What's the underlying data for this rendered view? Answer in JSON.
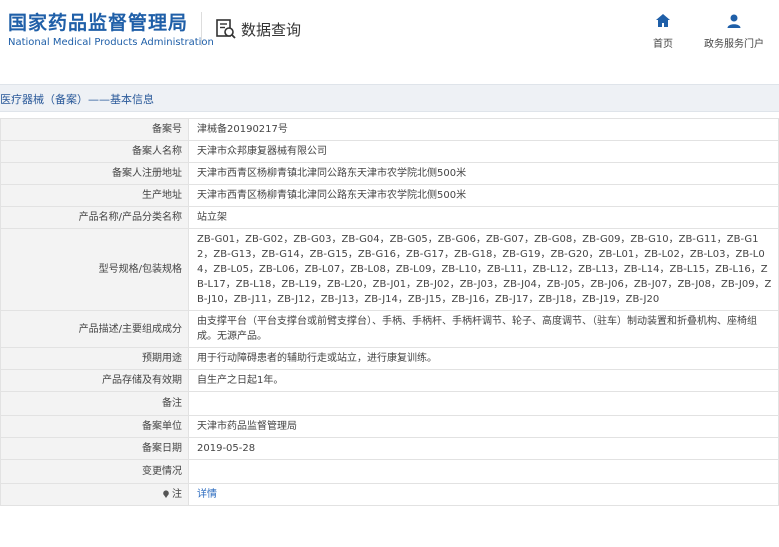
{
  "header": {
    "logo_cn": "国家药品监督管理局",
    "logo_en": "National Medical Products Administration",
    "query_label": "数据查询",
    "nav_home": "首页",
    "nav_gov": "政务服务门户"
  },
  "breadcrumb": "医疗器械（备案）——基本信息",
  "rows": [
    {
      "label": "备案号",
      "value": "津械备20190217号"
    },
    {
      "label": "备案人名称",
      "value": "天津市众邦康复器械有限公司"
    },
    {
      "label": "备案人注册地址",
      "value": "天津市西青区杨柳青镇北津同公路东天津市农学院北侧500米"
    },
    {
      "label": "生产地址",
      "value": "天津市西青区杨柳青镇北津同公路东天津市农学院北侧500米"
    },
    {
      "label": "产品名称/产品分类名称",
      "value": "站立架"
    },
    {
      "label": "型号规格/包装规格",
      "value": "ZB-G01，ZB-G02，ZB-G03，ZB-G04，ZB-G05，ZB-G06，ZB-G07，ZB-G08，ZB-G09，ZB-G10，ZB-G11，ZB-G12，ZB-G13，ZB-G14，ZB-G15，ZB-G16，ZB-G17，ZB-G18，ZB-G19，ZB-G20，ZB-L01，ZB-L02，ZB-L03，ZB-L04，ZB-L05，ZB-L06，ZB-L07，ZB-L08，ZB-L09，ZB-L10，ZB-L11，ZB-L12，ZB-L13，ZB-L14，ZB-L15，ZB-L16，ZB-L17，ZB-L18，ZB-L19，ZB-L20，ZB-J01，ZB-J02，ZB-J03，ZB-J04，ZB-J05，ZB-J06，ZB-J07，ZB-J08，ZB-J09，ZB-J10，ZB-J11，ZB-J12，ZB-J13，ZB-J14，ZB-J15，ZB-J16，ZB-J17，ZB-J18，ZB-J19，ZB-J20"
    },
    {
      "label": "产品描述/主要组成成分",
      "value": "由支撑平台（平台支撑台或前臂支撑台）、手柄、手柄杆、手柄杆调节、轮子、高度调节、（驻车）制动装置和折叠机构、座椅组成。无源产品。"
    },
    {
      "label": "预期用途",
      "value": "用于行动障碍患者的辅助行走或站立，进行康复训练。"
    },
    {
      "label": "产品存储及有效期",
      "value": "自生产之日起1年。"
    },
    {
      "label": "备注",
      "value": ""
    },
    {
      "label": "备案单位",
      "value": "天津市药品监督管理局"
    },
    {
      "label": "备案日期",
      "value": "2019-05-28"
    },
    {
      "label": "变更情况",
      "value": ""
    }
  ],
  "note_row": {
    "label": "注",
    "link": "详情"
  },
  "colors": {
    "brand": "#1f5fa8",
    "link": "#2b6bbf"
  }
}
